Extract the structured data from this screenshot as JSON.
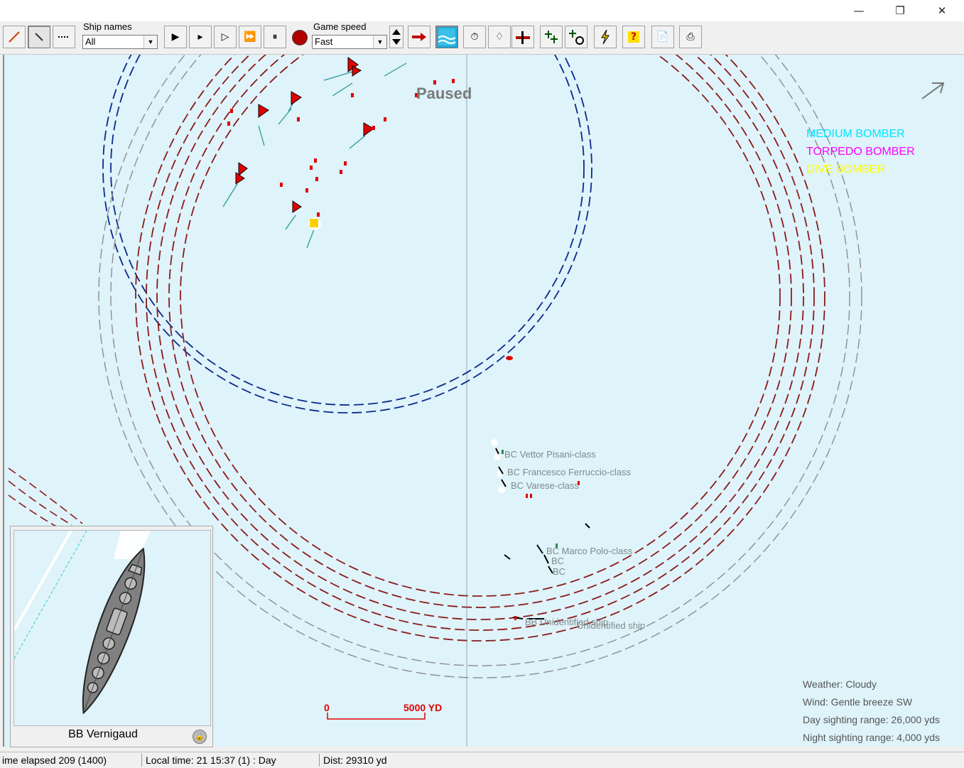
{
  "window": {
    "minimize_icon": "minimize-icon",
    "restore_icon": "restore-icon",
    "close_icon": "close-icon"
  },
  "toolbar": {
    "ship_names_label": "Ship names",
    "ship_names_value": "All",
    "game_speed_label": "Game speed",
    "game_speed_value": "Fast"
  },
  "map": {
    "paused_text": "Paused",
    "legend": [
      {
        "text": "MEDIUM BOMBER",
        "color": "#00e5ff"
      },
      {
        "text": "TORPEDO BOMBER",
        "color": "#ff00ff"
      },
      {
        "text": "DIVE BOMBER",
        "color": "#ffff00"
      }
    ],
    "ship_labels": [
      "BC Vettor Pisani-class",
      "BC Francesco Ferruccio-class",
      "BC Varese-class",
      "BC Marco Polo-class",
      "BC",
      "BC",
      "BB Unidentified ship",
      "Unidentified ship"
    ],
    "scale": {
      "start": "0",
      "end": "5000 YD"
    },
    "weather": "Weather: Cloudy",
    "wind": "Wind: Gentle breeze  SW",
    "day_range": "Day sighting range: 26,000 yds",
    "night_range": "Night sighting range: 4,000 yds"
  },
  "inset": {
    "ship_name": "BB Vernigaud"
  },
  "status": {
    "elapsed": "ime elapsed 209 (1400)",
    "local_time": "Local time: 21 15:37 (1) : Day",
    "distance": "Dist: 29310 yd"
  },
  "colors": {
    "sea": "#def3fa",
    "enemy_flag": "#e00000",
    "own_range": "#0a2a8c",
    "enemy_range": "#8b1a1a",
    "scale": "#e00000"
  }
}
